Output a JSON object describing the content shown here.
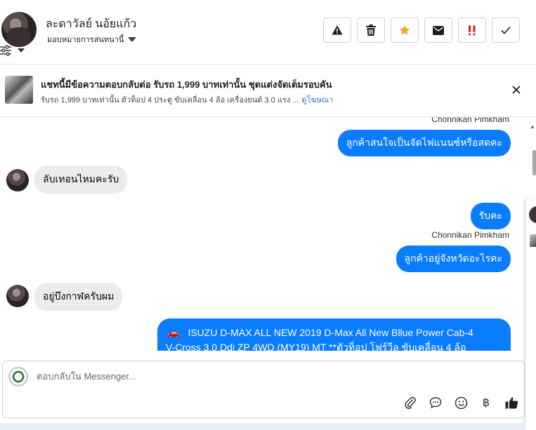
{
  "header": {
    "contact_name": "ละดาวัลย์ นอ้ยแก้ว",
    "assign_label": "มอบหมายการสนทนานี้",
    "actions": [
      {
        "name": "report-button",
        "icon": "warning-icon"
      },
      {
        "name": "delete-button",
        "icon": "trash-icon"
      },
      {
        "name": "star-button",
        "icon": "star-icon",
        "color": "#f5a623"
      },
      {
        "name": "mail-button",
        "icon": "envelope-icon"
      },
      {
        "name": "important-button",
        "icon": "double-exclamation-icon",
        "color": "#e02020"
      },
      {
        "name": "done-button",
        "icon": "check-icon"
      }
    ]
  },
  "ad": {
    "title": "แชทนี้มีข้อความตอบกลับต่อ รับรถ 1,999 บาทเท่านั้น ชุดแต่งจัดเต็มรอบคัน",
    "subtitle": "รับรถ 1,999 บาทเท่านั้น ตัวท็อป 4 ประตู ขับเคลื่อน 4 ล้อ เครื่องยนต์ 3.0 แรง ...",
    "link": "ดูโฆษณา"
  },
  "messages": {
    "agent_name_1": "Chonnikan Pimkham",
    "out_1": "ลูกค้าสนใจเป็นจัดไฟแนนซ์หรือสดคะ",
    "in_1": "ลับเทอนไหมคะรับ",
    "out_2": "รับคะ",
    "agent_name_2": "Chonnikan Pimkham",
    "out_3": "ลูกค้าอยู่จังหวัดอะไรคะ",
    "in_2": "อยู่บึงกาฬครับผม",
    "out_long_line1": "ISUZU D-MAX ALL NEW 2019 D-Max All New Bllue Power Cab-4",
    "out_long_line2": "V-Cross 3.0 Ddi ZP 4WD (MY19) MT **ตัวท็อป โฟร์วีล ขับเคลื่อน 4 ล้อ"
  },
  "composer": {
    "placeholder": "ตอบกลับใน Messenger...",
    "tools": [
      "paperclip-icon",
      "chat-bubble-icon",
      "emoji-icon",
      "baht-icon",
      "thumbs-up-icon"
    ],
    "baht_symbol": "฿"
  },
  "colors": {
    "outgoing_bubble": "#0a7cff",
    "incoming_bubble": "#ececec",
    "link": "#216fdb"
  }
}
